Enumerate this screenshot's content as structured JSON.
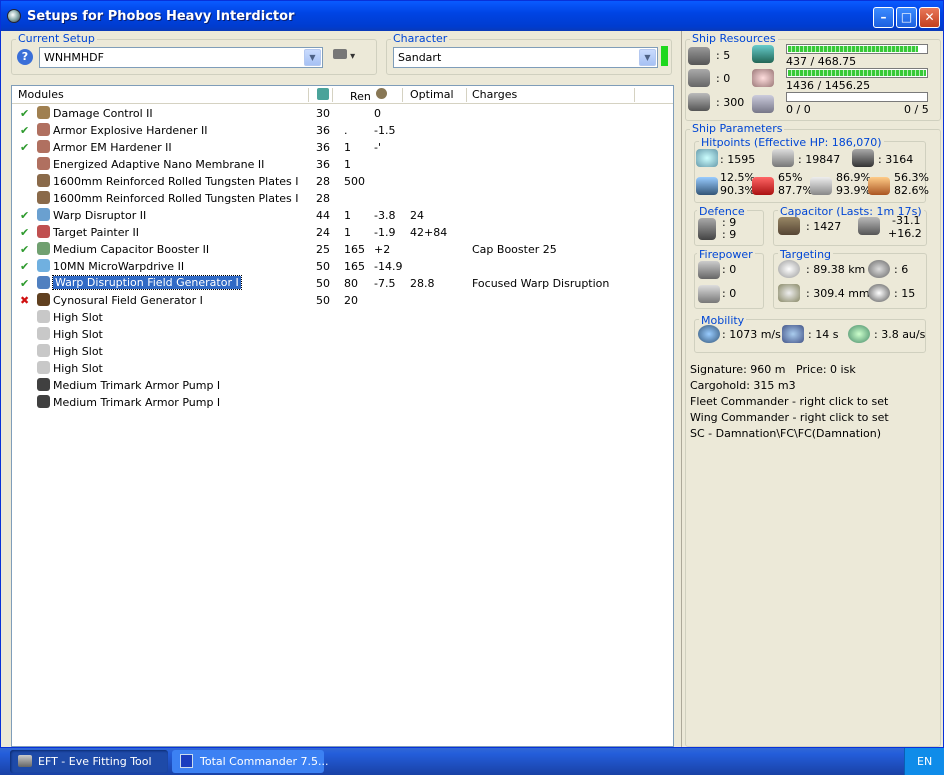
{
  "window": {
    "title": "Setups for Phobos Heavy Interdictor"
  },
  "current_setup": {
    "label": "Current Setup",
    "value": "WNHMHDF"
  },
  "character": {
    "label": "Character",
    "value": "Sandart"
  },
  "modules": {
    "headers": {
      "modules": "Modules",
      "cpu": "",
      "rem": "Ren",
      "cap": "",
      "optimal": "Optimal",
      "charges": "Charges"
    },
    "rows": [
      {
        "status": "ok",
        "icon": "damage-control-icon",
        "name": "Damage Control II",
        "cpu": "30",
        "pg": "",
        "cap": "0",
        "optimal": "",
        "charges": ""
      },
      {
        "status": "ok",
        "icon": "armor-hardener-icon",
        "name": "Armor Explosive Hardener II",
        "cpu": "36",
        "pg": ".",
        "cap": "-1.5",
        "optimal": "",
        "charges": ""
      },
      {
        "status": "ok",
        "icon": "armor-hardener-icon",
        "name": "Armor EM Hardener II",
        "cpu": "36",
        "pg": "1",
        "cap": "-'",
        "optimal": "",
        "charges": ""
      },
      {
        "status": "",
        "icon": "armor-hardener-icon",
        "name": "Energized Adaptive Nano Membrane II",
        "cpu": "36",
        "pg": "1",
        "cap": "",
        "optimal": "",
        "charges": ""
      },
      {
        "status": "",
        "icon": "armor-plate-icon",
        "name": "1600mm Reinforced Rolled Tungsten Plates I",
        "cpu": "28",
        "pg": "500",
        "cap": "",
        "optimal": "",
        "charges": ""
      },
      {
        "status": "",
        "icon": "armor-plate-icon",
        "name": "1600mm Reinforced Rolled Tungsten Plates I",
        "cpu": "28",
        "pg": "",
        "cap": "",
        "optimal": "",
        "charges": ""
      },
      {
        "status": "ok",
        "icon": "warp-disruptor-icon",
        "name": "Warp Disruptor II",
        "cpu": "44",
        "pg": "1",
        "cap": "-3.8",
        "optimal": "24",
        "charges": ""
      },
      {
        "status": "ok",
        "icon": "target-painter-icon",
        "name": "Target Painter II",
        "cpu": "24",
        "pg": "1",
        "cap": "-1.9",
        "optimal": "42+84",
        "charges": ""
      },
      {
        "status": "ok",
        "icon": "cap-booster-icon",
        "name": "Medium Capacitor Booster II",
        "cpu": "25",
        "pg": "165",
        "cap": "+2",
        "optimal": "",
        "charges": "Cap Booster 25"
      },
      {
        "status": "ok",
        "icon": "microwarpdrive-icon",
        "name": "10MN MicroWarpdrive II",
        "cpu": "50",
        "pg": "165",
        "cap": "-14.9",
        "optimal": "",
        "charges": ""
      },
      {
        "status": "ok",
        "icon": "warp-field-icon",
        "name": "Warp Disruption Field Generator I",
        "cpu": "50",
        "pg": "80",
        "cap": "-7.5",
        "optimal": "28.8",
        "charges": "Focused Warp Disruption",
        "selected": true
      },
      {
        "status": "bad",
        "icon": "cyno-icon",
        "name": "Cynosural Field Generator I",
        "cpu": "50",
        "pg": "20",
        "cap": "",
        "optimal": "",
        "charges": ""
      },
      {
        "status": "",
        "icon": "high-slot-icon",
        "name": "High Slot",
        "cpu": "",
        "pg": "",
        "cap": "",
        "optimal": "",
        "charges": ""
      },
      {
        "status": "",
        "icon": "high-slot-icon",
        "name": "High Slot",
        "cpu": "",
        "pg": "",
        "cap": "",
        "optimal": "",
        "charges": ""
      },
      {
        "status": "",
        "icon": "high-slot-icon",
        "name": "High Slot",
        "cpu": "",
        "pg": "",
        "cap": "",
        "optimal": "",
        "charges": ""
      },
      {
        "status": "",
        "icon": "high-slot-icon",
        "name": "High Slot",
        "cpu": "",
        "pg": "",
        "cap": "",
        "optimal": "",
        "charges": ""
      },
      {
        "status": "",
        "icon": "rig-icon",
        "name": "Medium Trimark Armor Pump I",
        "cpu": "",
        "pg": "",
        "cap": "",
        "optimal": "",
        "charges": ""
      },
      {
        "status": "",
        "icon": "rig-icon",
        "name": "Medium Trimark Armor Pump I",
        "cpu": "",
        "pg": "",
        "cap": "",
        "optimal": "",
        "charges": ""
      }
    ]
  },
  "resources": {
    "label": "Ship Resources",
    "turret": ": 5",
    "launcher": ": 0",
    "drone_bay": ": 300",
    "cpu": "437 / 468.75",
    "cpu_fill": 0.93,
    "pg": "1436 / 1456.25",
    "pg_fill": 0.986,
    "calib": "0 / 0",
    "drones": "0 / 5"
  },
  "params": {
    "label": "Ship Parameters",
    "hp_label": "Hitpoints (Effective HP: 186,070)",
    "shield_hp": ": 1595",
    "armor_hp": ": 19847",
    "hull_hp": ": 3164",
    "res": {
      "s1": "12.5%",
      "s2": "90.3%",
      "t1": "65%",
      "t2": "87.7%",
      "k1": "86.9%",
      "k2": "93.9%",
      "e1": "56.3%",
      "e2": "82.6%"
    },
    "defence_label": "Defence",
    "def1": ": 9",
    "def2": ": 9",
    "cap_label": "Capacitor (Lasts: 1m 17s)",
    "cap_amount": ": 1427",
    "cap_delta1": "-31.1",
    "cap_delta2": "+16.2",
    "fire_label": "Firepower",
    "fire1": ": 0",
    "fire2": ": 0",
    "target_label": "Targeting",
    "t_range": ": 89.38 km",
    "t_max": ": 6",
    "t_res": ": 309.4 mm",
    "t_sensor": ": 15",
    "mob_label": "Mobility",
    "speed": ": 1073 m/s",
    "align": ": 14 s",
    "warp": ": 3.8 au/s"
  },
  "info": {
    "signature": "Signature: 960 m",
    "price": "Price: 0 isk",
    "cargo": "Cargohold: 315 m3",
    "fleet": "Fleet Commander - right click to set",
    "wing": "Wing Commander - right click to set",
    "sc": "SC - Damnation\\FC\\FC(Damnation)"
  },
  "taskbar": {
    "eft": "EFT - Eve Fitting Tool",
    "tc": "Total Commander 7.5...",
    "lang": "EN"
  },
  "colors": {
    "title": "#0044e4",
    "select": "#316ac5",
    "ok": "#2e9a2e",
    "bad": "#d01010"
  }
}
